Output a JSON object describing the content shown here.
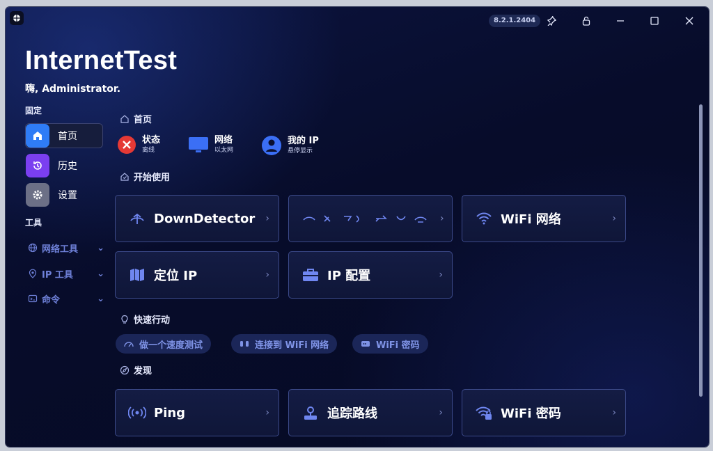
{
  "window": {
    "version": "8.2.1.2404",
    "title": "InternetTest",
    "greeting": "嗨, Administrator."
  },
  "sidebar": {
    "pinned_header": "固定",
    "pinned": [
      {
        "label": "首页",
        "icon": "home-icon",
        "color": "#2f7cf6"
      },
      {
        "label": "历史",
        "icon": "history-icon",
        "color": "#7b3ff0"
      },
      {
        "label": "设置",
        "icon": "gear-icon",
        "color": "#6c7086"
      }
    ],
    "tools_header": "工具",
    "tools": [
      {
        "label": "网络工具",
        "icon": "globe-icon"
      },
      {
        "label": "IP 工具",
        "icon": "location-pin-icon"
      },
      {
        "label": "命令",
        "icon": "command-icon"
      }
    ]
  },
  "main": {
    "home_section": "首页",
    "status": [
      {
        "title": "状态",
        "subtitle": "离线",
        "icon": "offline-x-icon",
        "color": "#e53935"
      },
      {
        "title": "网络",
        "subtitle": "以太网",
        "icon": "monitor-icon",
        "color": "#3b6ff5"
      },
      {
        "title": "我的 IP",
        "subtitle": "悬停显示",
        "icon": "user-globe-icon",
        "color": "#3b6ff5"
      }
    ],
    "start_section": "开始使用",
    "cards_row1": [
      {
        "label": "DownDetector",
        "icon": "signal-icon"
      },
      {
        "label": "",
        "icon": "loading-icon"
      },
      {
        "label": "WiFi 网络",
        "icon": "wifi-icon"
      }
    ],
    "cards_row2": [
      {
        "label": "定位 IP",
        "icon": "map-icon"
      },
      {
        "label": "IP 配置",
        "icon": "toolbox-icon"
      }
    ],
    "quick_section": "快速行动",
    "quick_actions": [
      {
        "label": "做一个速度测试",
        "icon": "gauge-icon"
      },
      {
        "label": "连接到 WiFi 网络",
        "icon": "connect-icon"
      },
      {
        "label": "WiFi 密码",
        "icon": "password-icon"
      }
    ],
    "discover_section": "发现",
    "discover_cards": [
      {
        "label": "Ping",
        "icon": "ping-icon"
      },
      {
        "label": "追踪路线",
        "icon": "route-icon"
      },
      {
        "label": "WiFi 密码",
        "icon": "wifi-lock-icon"
      }
    ]
  },
  "colors": {
    "accent": "#3b6ff5",
    "card_border": "#3c4a8a",
    "chip_text": "#7f93e6"
  }
}
